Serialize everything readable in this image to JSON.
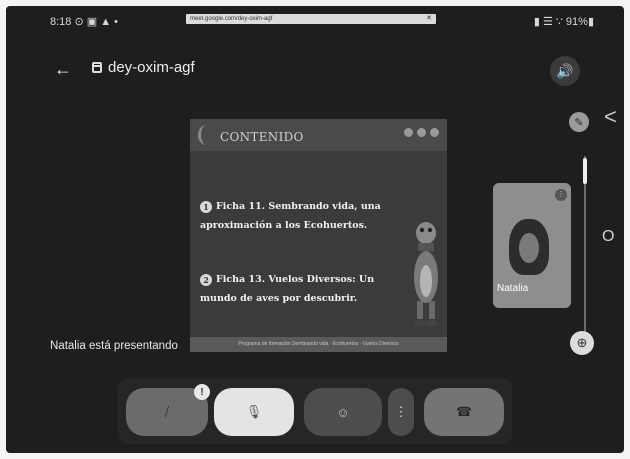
{
  "status_bar": {
    "time": "8:18",
    "indicators_left": "⊙ ▣ ▲ •",
    "indicators_right": "▮ ☰ ∵ 91%▮"
  },
  "url_bar": {
    "text": "meet.google.com/dey-oxim-agf",
    "close": "✕"
  },
  "header": {
    "back_glyph": "←",
    "meeting_code": "dey-oxim-agf",
    "speaker_glyph": "🔊"
  },
  "side": {
    "chevron": "<",
    "home_glyph": "O",
    "pin_glyph": "⊕",
    "small_avatar_glyph": "✎"
  },
  "slide": {
    "title": "CONTENIDO",
    "items": [
      {
        "num": "1",
        "text": "Ficha 11. Sembrando vida, una aproximación a los Ecohuertos."
      },
      {
        "num": "2",
        "text": "Ficha 13. Vuelos Diversos: Un mundo de aves por descubrir."
      }
    ],
    "footer": "Programa de formación Sembrando vida · Ecohuertos · Vuelos Diversos"
  },
  "participant": {
    "name": "Natalia",
    "more_glyph": "⋮"
  },
  "presenting_text": "Natalia está presentando",
  "controls": {
    "camera_glyph": "⧸",
    "mic_glyph": "🎙",
    "emoji_glyph": "☺",
    "more_glyph": "⋮",
    "end_glyph": "☎",
    "badge": "!"
  }
}
